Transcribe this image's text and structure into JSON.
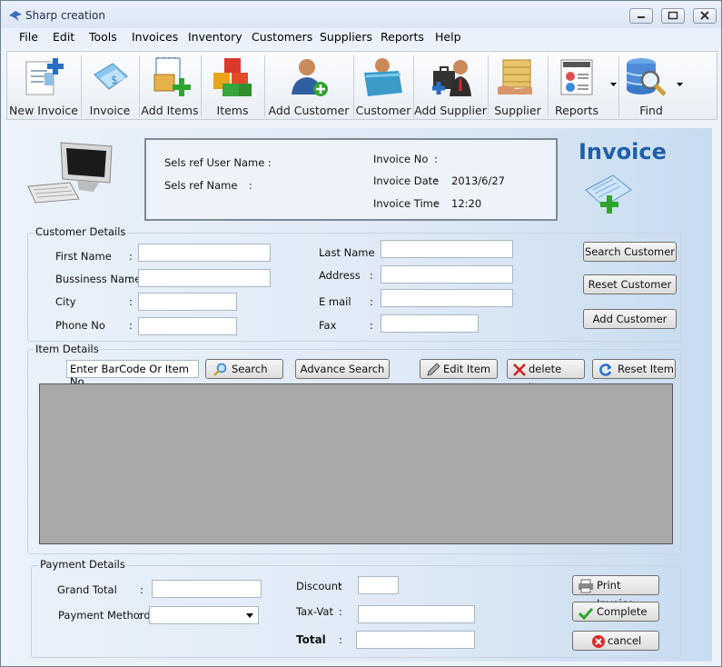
{
  "window": {
    "title": "Sharp creation"
  },
  "menu": [
    "File",
    "Edit",
    "Tools",
    "Invoices",
    "Inventory",
    "Customers",
    "Suppliers",
    "Reports",
    "Help"
  ],
  "toolbar": [
    {
      "label": "New Invoice",
      "icon": "new-invoice-icon"
    },
    {
      "label": "Invoice",
      "icon": "invoice-icon"
    },
    {
      "label": "Add Items",
      "icon": "add-items-icon"
    },
    {
      "label": "Items",
      "icon": "items-icon"
    },
    {
      "label": "Add Customer",
      "icon": "add-customer-icon"
    },
    {
      "label": "Customer",
      "icon": "customer-icon"
    },
    {
      "label": "Add Supplier",
      "icon": "add-supplier-icon"
    },
    {
      "label": "Supplier",
      "icon": "supplier-icon"
    },
    {
      "label": "Reports",
      "icon": "reports-icon"
    },
    {
      "label": "Find",
      "icon": "find-icon"
    }
  ],
  "header": {
    "user_label": "Sels ref User Name  :",
    "name_label": "Sels ref Name",
    "name_colon": ":",
    "invoice_no_label": "Invoice No",
    "invoice_no_colon": ":",
    "invoice_date_label": "Invoice Date",
    "invoice_date_colon": ":",
    "invoice_date": "2013/6/27",
    "invoice_time_label": "Invoice Time",
    "invoice_time_colon": ":",
    "invoice_time": "12:20",
    "title": "Invoice"
  },
  "customer": {
    "group": "Customer Details",
    "first_name": "First Name",
    "business_name": "Bussiness Name",
    "city": "City",
    "phone": "Phone No",
    "last_name": "Last Name",
    "address": "Address",
    "email": "E mail",
    "fax": "Fax",
    "colon": ":",
    "search_button": "Search Customer",
    "reset_button": "Reset Customer",
    "add_button": "Add Customer"
  },
  "items": {
    "group": "Item Details",
    "barcode_value": "Enter BarCode Or Item No",
    "search": "Search",
    "advance_search": "Advance Search",
    "edit": "Edit Item",
    "delete": "delete Item",
    "reset": "Reset Item"
  },
  "payment": {
    "group": "Payment Details",
    "grand_total": "Grand Total",
    "payment_method": "Payment Methord",
    "discount": "Discount",
    "tax": "Tax-Vat",
    "total": "Total",
    "colon": ":",
    "print": "Print Invoice",
    "complete": "Complete",
    "cancel": "cancel"
  }
}
